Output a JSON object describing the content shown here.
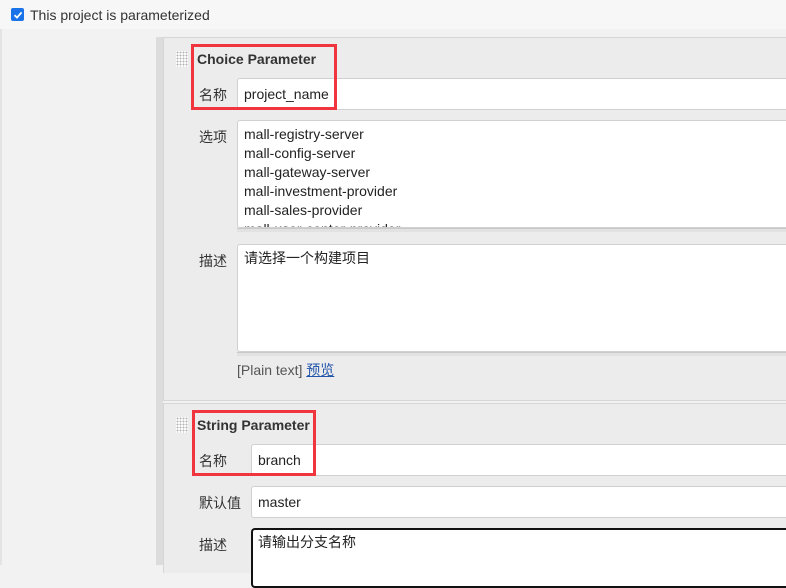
{
  "header": {
    "parameterized_checkbox": {
      "checked": true,
      "label": "This project is parameterized"
    }
  },
  "parameters": [
    {
      "type_title": "Choice Parameter",
      "fields": {
        "name_label": "名称",
        "name_value": "project_name",
        "choices_label": "选项",
        "choices": [
          "mall-registry-server",
          "mall-config-server",
          "mall-gateway-server",
          "mall-investment-provider",
          "mall-sales-provider",
          "mall-user-center-provider"
        ],
        "description_label": "描述",
        "description_value": "请选择一个构建项目",
        "format_hint": "[Plain text]",
        "preview_link": "预览"
      }
    },
    {
      "type_title": "String Parameter",
      "fields": {
        "name_label": "名称",
        "name_value": "branch",
        "default_label": "默认值",
        "default_value": "master",
        "description_label": "描述",
        "description_value": "请输出分支名称"
      }
    }
  ],
  "annotations": {
    "highlight_color": "#f0353e"
  }
}
